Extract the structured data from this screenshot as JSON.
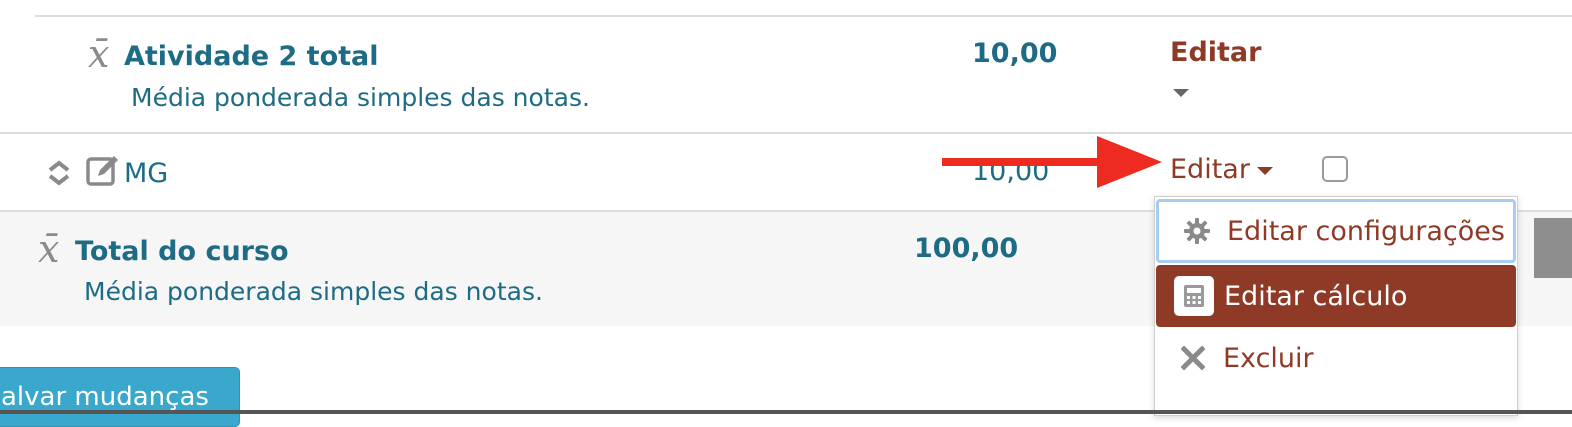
{
  "rows": [
    {
      "name": "Atividade 2 total",
      "description": "Média ponderada simples das notas.",
      "value": "10,00",
      "action": "Editar",
      "icon": "sigma-mean-icon"
    },
    {
      "name": "MG",
      "value": "10,00",
      "action": "Editar",
      "icons": [
        "move-icon",
        "edit-icon"
      ]
    },
    {
      "name": "Total do curso",
      "description": "Média ponderada simples das notas.",
      "value": "100,00",
      "icon": "sigma-mean-icon"
    }
  ],
  "dropdown": {
    "items": [
      {
        "label": "Editar configurações",
        "icon": "gear-icon"
      },
      {
        "label": "Editar cálculo",
        "icon": "calculator-icon",
        "active": true
      },
      {
        "label": "Excluir",
        "icon": "close-icon"
      }
    ]
  },
  "save_button": {
    "label": "alvar mudanças"
  },
  "colors": {
    "teal": "#1d6b84",
    "brown": "#8f3a26",
    "button": "#3aa8cc",
    "arrow": "#ee2b20"
  }
}
